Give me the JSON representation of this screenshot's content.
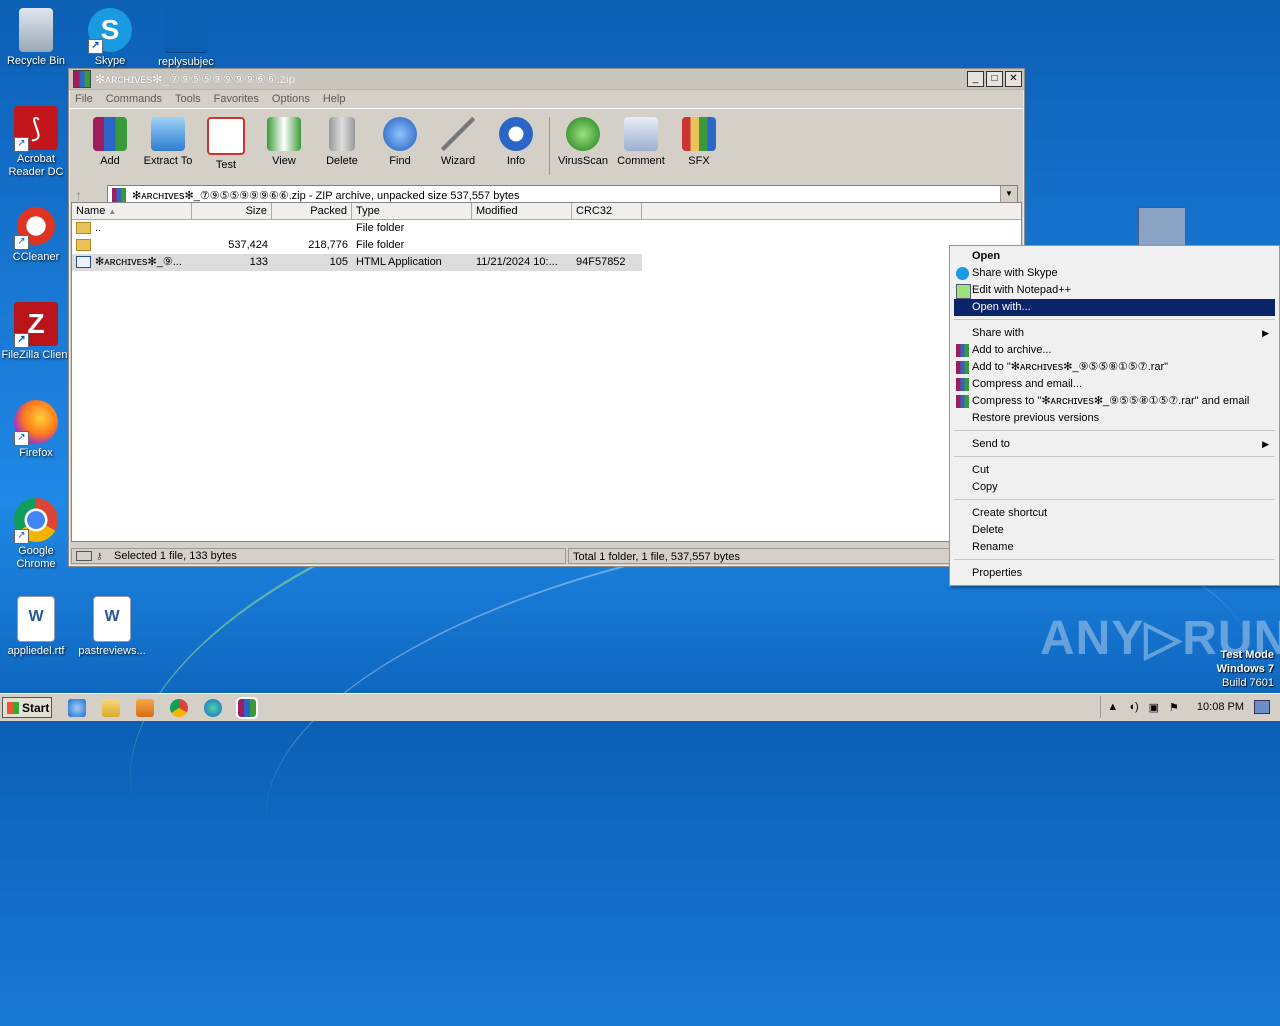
{
  "desktop": {
    "icons": [
      {
        "label": "Recycle Bin"
      },
      {
        "label": "Skype"
      },
      {
        "label": "replysubjec"
      },
      {
        "label": "Acrobat Reader DC"
      },
      {
        "label": "CCleaner"
      },
      {
        "label": "FileZilla Client"
      },
      {
        "label": "Firefox"
      },
      {
        "label": "Google Chrome"
      },
      {
        "label": "appliedel.rtf"
      },
      {
        "label": "pastreviews..."
      }
    ],
    "watermark": "ANY▷RUN",
    "test_mode": [
      "Test Mode",
      "Windows 7",
      "Build 7601"
    ]
  },
  "window": {
    "title": "✻ᴀʀᴄʜɪᴠᴇѕ✻_⑦⑨⑤⑤⑨⑨⑨⑨⑥⑥.zip",
    "menu": [
      "File",
      "Commands",
      "Tools",
      "Favorites",
      "Options",
      "Help"
    ],
    "toolbar": [
      "Add",
      "Extract To",
      "Test",
      "View",
      "Delete",
      "Find",
      "Wizard",
      "Info",
      "VirusScan",
      "Comment",
      "SFX"
    ],
    "path": "✻ᴀʀᴄʜɪᴠᴇѕ✻_⑦⑨⑤⑤⑨⑨⑨⑥⑥.zip - ZIP archive, unpacked size 537,557 bytes",
    "columns": [
      "Name",
      "Size",
      "Packed",
      "Type",
      "Modified",
      "CRC32"
    ],
    "rows": [
      {
        "name": "..",
        "size": "",
        "packed": "",
        "type": "File folder",
        "modified": "",
        "crc": ""
      },
      {
        "name": "",
        "size": "537,424",
        "packed": "218,776",
        "type": "File folder",
        "modified": "",
        "crc": ""
      },
      {
        "name": "✻ᴀʀᴄʜɪᴠᴇѕ✻_⑨...",
        "size": "133",
        "packed": "105",
        "type": "HTML Application",
        "modified": "11/21/2024 10:...",
        "crc": "94F57852"
      }
    ],
    "status_left": "Selected 1 file, 133 bytes",
    "status_right": "Total 1 folder, 1 file, 537,557 bytes"
  },
  "context_menu": {
    "open": "Open",
    "share_skype": "Share with Skype",
    "edit_notepad": "Edit with Notepad++",
    "open_with": "Open with...",
    "share_with": "Share with",
    "add_archive": "Add to archive...",
    "add_to_rar": "Add to \"✻ᴀʀᴄʜɪᴠᴇѕ✻_⑨⑤⑤⑧①⑤⑦.rar\"",
    "compress_email": "Compress and email...",
    "compress_to_rar_email": "Compress to \"✻ᴀʀᴄʜɪᴠᴇѕ✻_⑨⑤⑤⑧①⑤⑦.rar\" and email",
    "restore": "Restore previous versions",
    "send_to": "Send to",
    "cut": "Cut",
    "copy": "Copy",
    "create_shortcut": "Create shortcut",
    "delete": "Delete",
    "rename": "Rename",
    "properties": "Properties"
  },
  "taskbar": {
    "start": "Start",
    "clock": "10:08 PM"
  }
}
